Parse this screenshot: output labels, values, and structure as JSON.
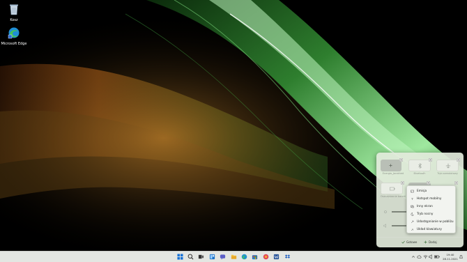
{
  "desktop": {
    "icons": [
      {
        "label": "Kosz",
        "icon": "recycle-bin-icon"
      },
      {
        "label": "Microsoft Edge",
        "icon": "edge-icon"
      }
    ]
  },
  "quick_settings": {
    "tiles": [
      {
        "label": "Energia_Jarakhed",
        "icon": "battery-saver-icon",
        "state": "on"
      },
      {
        "label": "Bluetooth",
        "icon": "bluetooth-icon",
        "state": "off"
      },
      {
        "label": "Tryb samolotowy",
        "icon": "airplane-icon",
        "state": "off"
      },
      {
        "label": "Oszczędzanie baterii",
        "icon": "battery-icon",
        "state": "off"
      }
    ],
    "footer": {
      "done_label": "Gotowe",
      "add_label": "Dodaj"
    }
  },
  "context_menu": {
    "items": [
      {
        "label": "Emisja",
        "icon": "cast-icon"
      },
      {
        "label": "Hotspot mobilny",
        "icon": "hotspot-icon"
      },
      {
        "label": "Inny ekran",
        "icon": "project-icon"
      },
      {
        "label": "Tryb nocny",
        "icon": "night-light-icon"
      },
      {
        "label": "Udostępnianie w pobliżu",
        "icon": "nearby-share-icon"
      },
      {
        "label": "Układ klawiatury",
        "icon": "keyboard-layout-icon"
      }
    ]
  },
  "taskbar": {
    "apps": [
      "start-icon",
      "search-icon",
      "task-view-icon",
      "widgets-icon",
      "chat-icon",
      "file-explorer-icon",
      "edge-icon",
      "store-icon",
      "mail-icon",
      "app-icon",
      "word-icon",
      "dropbox-icon"
    ],
    "tray": {
      "time": "19:40",
      "date": "28.11.2021"
    }
  },
  "colors": {
    "panel_bg": "#e1e9da",
    "taskbar_bg": "#e3e6e2",
    "accent": "#3b9a3b"
  }
}
